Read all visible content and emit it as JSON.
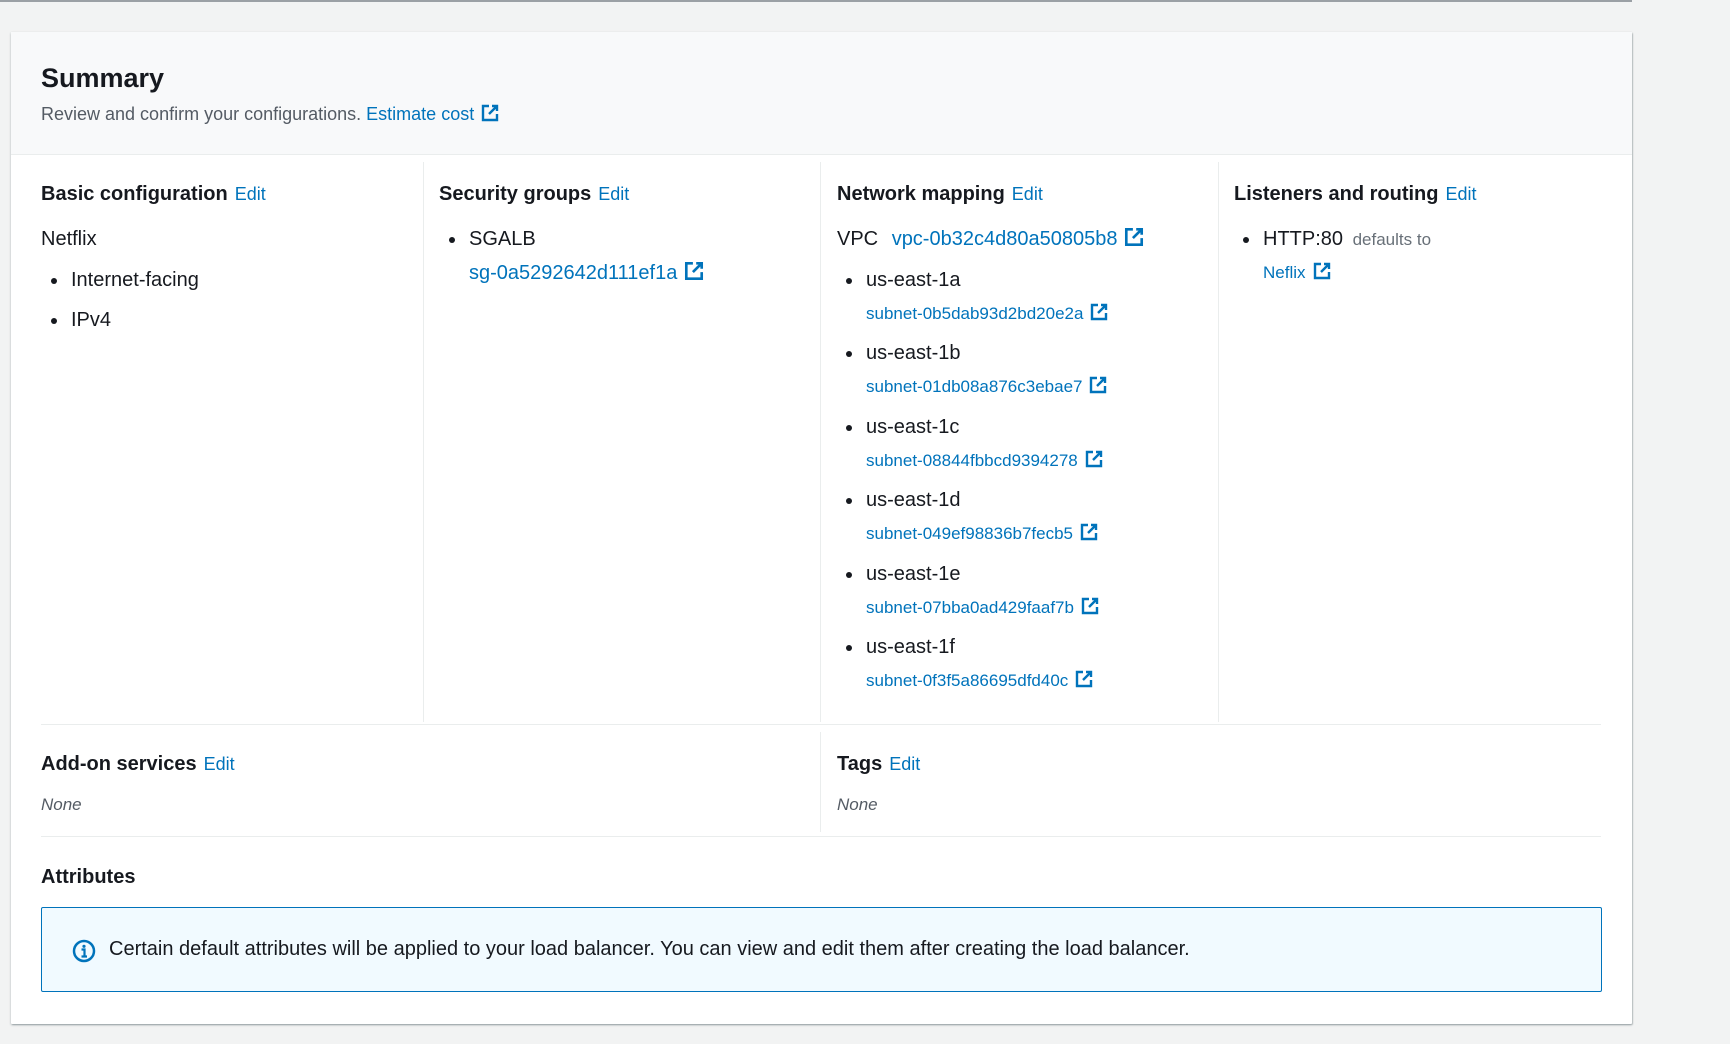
{
  "summary": {
    "title": "Summary",
    "description": "Review and confirm your configurations.",
    "estimate_link": "Estimate cost"
  },
  "basic": {
    "title": "Basic configuration",
    "edit": "Edit",
    "name": "Netflix",
    "items": [
      "Internet-facing",
      "IPv4"
    ]
  },
  "security": {
    "title": "Security groups",
    "edit": "Edit",
    "group_name": "SGALB",
    "group_id": "sg-0a5292642d111ef1a"
  },
  "network": {
    "title": "Network mapping",
    "edit": "Edit",
    "vpc_label": "VPC",
    "vpc_id": "vpc-0b32c4d80a50805b8",
    "zones": [
      {
        "az": "us-east-1a",
        "subnet": "subnet-0b5dab93d2bd20e2a"
      },
      {
        "az": "us-east-1b",
        "subnet": "subnet-01db08a876c3ebae7"
      },
      {
        "az": "us-east-1c",
        "subnet": "subnet-08844fbbcd9394278"
      },
      {
        "az": "us-east-1d",
        "subnet": "subnet-049ef98836b7fecb5"
      },
      {
        "az": "us-east-1e",
        "subnet": "subnet-07bba0ad429faaf7b"
      },
      {
        "az": "us-east-1f",
        "subnet": "subnet-0f3f5a86695dfd40c"
      }
    ]
  },
  "listeners": {
    "title": "Listeners and routing",
    "edit": "Edit",
    "protocol": "HTTP:80",
    "defaults_to": "defaults to",
    "target": "Neflix"
  },
  "addons": {
    "title": "Add-on services",
    "edit": "Edit",
    "value": "None"
  },
  "tags": {
    "title": "Tags",
    "edit": "Edit",
    "value": "None"
  },
  "attributes": {
    "title": "Attributes",
    "alert": "Certain default attributes will be applied to your load balancer. You can view and edit them after creating the load balancer."
  },
  "colors": {
    "link": "#0073bb",
    "text": "#16191f",
    "muted": "#545b64",
    "alert_bg": "#f1faff"
  },
  "icons": {
    "external": "external-link-icon",
    "info": "info-icon"
  }
}
